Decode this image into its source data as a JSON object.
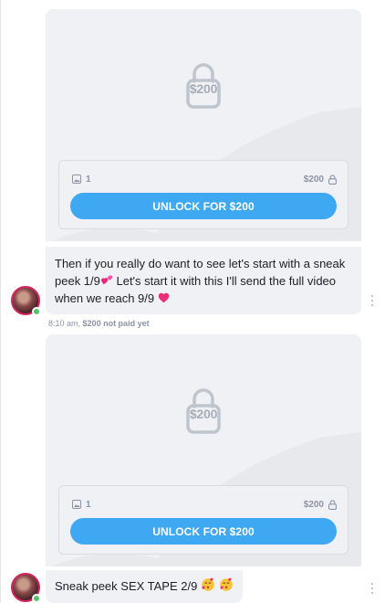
{
  "messages": [
    {
      "locked_media": {
        "lock_price": "$200",
        "media_count": "1",
        "price": "$200",
        "unlock_label": "UNLOCK FOR $200"
      },
      "text": "Then if you really do want to see let's start with a sneak peek 1/9",
      "text_after": " Let's start it with this I'll send the full video when we reach 9/9",
      "icons": [
        "two-hearts-icon",
        "heart-icon"
      ],
      "time": "8:10 am,",
      "status": "$200 not paid yet"
    },
    {
      "locked_media": {
        "lock_price": "$200",
        "media_count": "1",
        "price": "$200",
        "unlock_label": "UNLOCK FOR $200"
      },
      "text": "Sneak peek SEX TAPE 2/9",
      "icons": [
        "kissing-face-icon",
        "kissing-face-icon"
      ]
    }
  ],
  "colors": {
    "accent": "#3ea8f3",
    "bubble": "#f0f1f4",
    "online": "#4fc26a"
  }
}
